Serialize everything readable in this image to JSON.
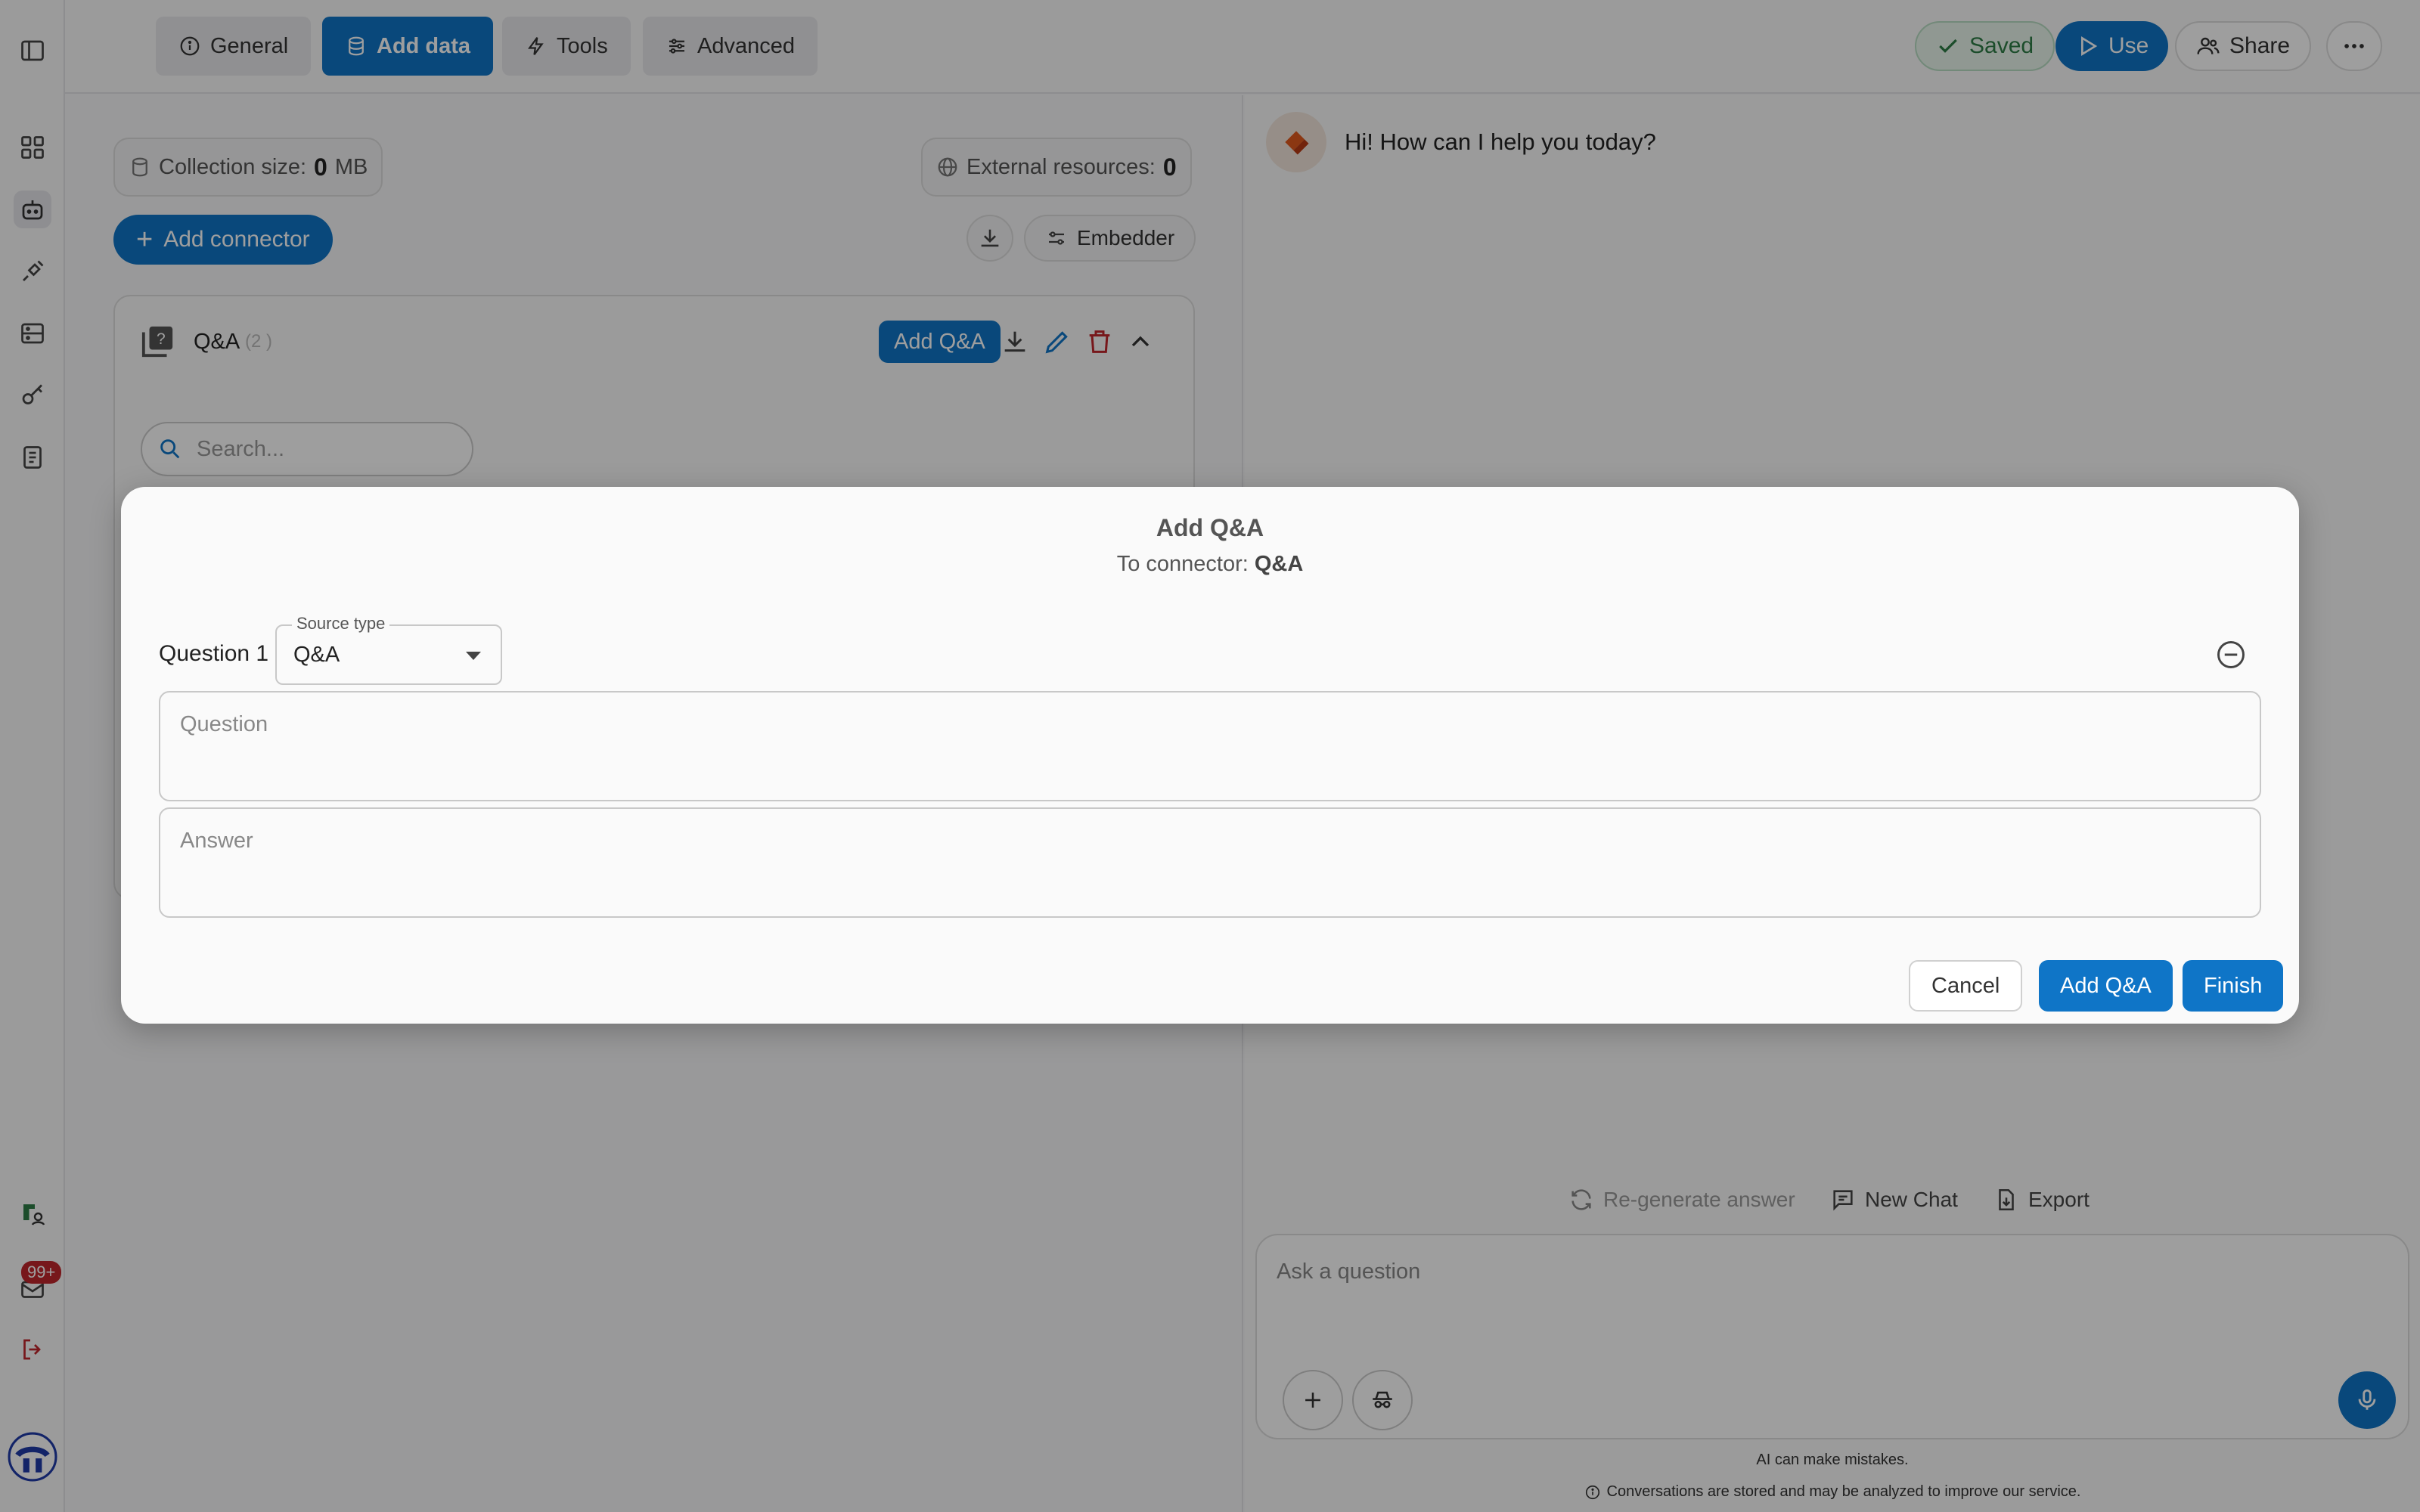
{
  "topbar": {
    "tabs": [
      {
        "label": "General",
        "icon": "info-icon"
      },
      {
        "label": "Add data",
        "icon": "database-icon"
      },
      {
        "label": "Tools",
        "icon": "bolt-icon"
      },
      {
        "label": "Advanced",
        "icon": "sliders-icon"
      }
    ],
    "saved_label": "Saved",
    "use_label": "Use",
    "share_label": "Share"
  },
  "rail": {
    "badge": "99+"
  },
  "left": {
    "collection_label": "Collection size:",
    "collection_value": "0",
    "collection_unit": "MB",
    "external_label": "External resources:",
    "external_value": "0",
    "add_connector": "Add connector",
    "embedder": "Embedder",
    "qa_title": "Q&A",
    "qa_count": "(2 )",
    "qa_add": "Add Q&A",
    "search_placeholder": "Search..."
  },
  "chat": {
    "greeting": "Hi! How can I help you today?",
    "regenerate": "Re-generate answer",
    "new_chat": "New Chat",
    "export": "Export",
    "ask_placeholder": "Ask a question",
    "disclaimer": "AI can make mistakes.",
    "privacy": "Conversations are stored and may be analyzed to improve our service."
  },
  "modal": {
    "title": "Add Q&A",
    "subtitle_prefix": "To connector:",
    "subtitle_connector": "Q&A",
    "question_label": "Question 1",
    "source_type_legend": "Source type",
    "source_type_value": "Q&A",
    "question_placeholder": "Question",
    "answer_placeholder": "Answer",
    "cancel": "Cancel",
    "add_qa": "Add Q&A",
    "finish": "Finish"
  },
  "colors": {
    "accent": "#0f75c7",
    "danger": "#c0262d",
    "saved_green": "#2e7d46"
  }
}
